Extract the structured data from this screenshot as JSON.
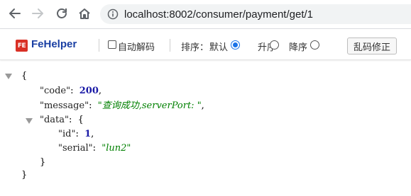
{
  "browser": {
    "url": "localhost:8002/consumer/payment/get/1"
  },
  "fehelper": {
    "logo_text": "FE",
    "title": "FeHelper",
    "auto_decode_label": "自动解码",
    "sort_label": "排序：",
    "sort_options": [
      "默认",
      "升序",
      "降序"
    ],
    "sort_selected": "默认",
    "fix_button": "乱码修正"
  },
  "json": {
    "open_brace": "{",
    "close_brace": "}",
    "code_key": "\"code\"",
    "code_value": "200",
    "message_key": "\"message\"",
    "message_value": "\"查询成功,serverPort: \"",
    "data_key": "\"data\"",
    "data_open": "{",
    "data_close": "}",
    "id_key": "\"id\"",
    "id_value": "1",
    "serial_key": "\"serial\"",
    "serial_value": "\"lun2\""
  },
  "colors": {
    "number": "#1a1aa6",
    "string": "#008000",
    "fehelper_title": "#1a3fa3",
    "logo": "#d93025",
    "radio_checked": "#1a73e8"
  }
}
